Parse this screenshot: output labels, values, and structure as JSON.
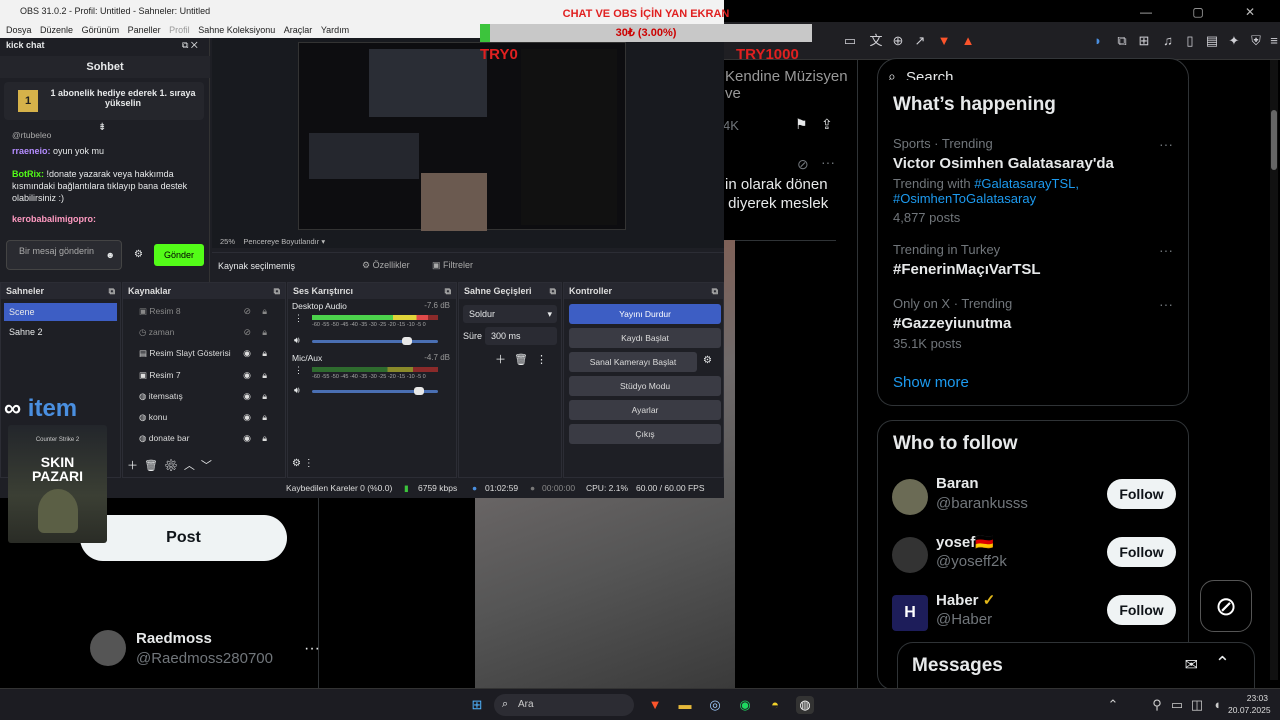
{
  "obs": {
    "title": "OBS 31.0.2 - Profil: Untitled - Sahneler: Untitled",
    "menu": [
      "Dosya",
      "Düzenle",
      "Görünüm",
      "Paneller",
      "Profil",
      "Sahne Koleksiyonu",
      "Araçlar",
      "Yardım"
    ],
    "chat_dock": {
      "title": "kick chat",
      "header": "Sohbet",
      "banner": "1 abonelik hediye ederek 1. sıraya yükselin",
      "rank": "1",
      "handle": "@rtubeleo",
      "messages": [
        {
          "user": "rraeneio:",
          "text": "oyun yok mu"
        },
        {
          "user": "BotRix:",
          "text": "!donate yazarak veya hakkımda kısmındaki bağlantılara tıklayıp bana destek olabilirsiniz :)"
        },
        {
          "user": "kerobabalimigopro:",
          "text": ""
        }
      ],
      "input_placeholder": "Bir mesaj gönderin",
      "send_label": "Gönder"
    },
    "preview": {
      "zoom": "25%",
      "resize_label": "Pencereye Boyutlandır",
      "no_source": "Kaynak seçilmemiş",
      "properties": "Özellikler",
      "filters": "Filtreler"
    },
    "scenes": {
      "title": "Sahneler",
      "items": [
        "Scene",
        "Sahne 2"
      ]
    },
    "sources": {
      "title": "Kaynaklar",
      "items": [
        "Resim 8",
        "zaman",
        "Resim Slayt Gösterisi",
        "Resim 7",
        "itemsatış",
        "konu",
        "donate bar"
      ]
    },
    "mixer": {
      "title": "Ses Karıştırıcı",
      "channels": [
        {
          "name": "Desktop Audio",
          "db": "-7.6 dB",
          "level": 0.92,
          "volume": 0.75
        },
        {
          "name": "Mic/Aux",
          "db": "-4.7 dB",
          "level": 0.0,
          "volume": 0.85
        }
      ],
      "scale": "-60 -55 -50 -45 -40 -35 -30 -25 -20 -15 -10 -5 0"
    },
    "transitions": {
      "title": "Sahne Geçişleri",
      "type": "Soldur",
      "duration_label": "Süre",
      "duration": "300 ms"
    },
    "controls": {
      "title": "Kontroller",
      "buttons": [
        "Yayını Durdur",
        "Kaydı Başlat",
        "Sanal Kamerayı Başlat",
        "Stüdyo Modu",
        "Ayarlar",
        "Çıkış"
      ]
    },
    "status": {
      "dropped": "Kaybedilen Kareler 0 (%0.0)",
      "bitrate": "6759 kbps",
      "live_time": "01:02:59",
      "rec_time": "00:00:00",
      "cpu": "CPU: 2.1%",
      "fps": "60.00 / 60.00 FPS"
    }
  },
  "overlay": {
    "bar_title": "CHAT VE OBS İÇİN YAN EKRAN",
    "bar_value": "30₺ (3.00%)",
    "bar_progress": 0.03,
    "left_amount": "TRY0",
    "right_amount": "TRY1000",
    "skin_title": "SKIN PAZARI",
    "skin_small": "Counter Strike 2",
    "brand": "item"
  },
  "x": {
    "search_placeholder": "Search",
    "whats_happening": "What’s happening",
    "trends": [
      {
        "meta": "Sports · Trending",
        "name": "Victor Osimhen Galatasaray'da",
        "sub_prefix": "Trending with",
        "tags": "#GalatasarayTSL, #OsimhenToGalatasaray",
        "posts": "4,877 posts"
      },
      {
        "meta": "Trending in Turkey",
        "name": "#FenerinMaçıVarTSL"
      },
      {
        "meta": "Only on X · Trending",
        "name": "#Gazzeyiunutma",
        "posts": "35.1K posts"
      }
    ],
    "show_more": "Show more",
    "who_to_follow": "Who to follow",
    "follow": [
      {
        "name": "Baran",
        "handle": "@barankusss"
      },
      {
        "name": "yosef🇩🇪",
        "handle": "@yoseff2k"
      },
      {
        "name": "Haber",
        "handle": "@Haber"
      }
    ],
    "follow_label": "Follow",
    "messages": "Messages",
    "feed_snippet1": "Kendine Müzisyen ve",
    "feed_snippet2": "in olarak dönen",
    "feed_snippet3": "” diyerek meslek",
    "count": "4K",
    "post_btn": "Post",
    "user": {
      "name": "Raedmoss",
      "handle": "@Raedmoss280700"
    }
  },
  "taskbar": {
    "search": "Ara",
    "time": "23:03",
    "date": "20.07.2025"
  }
}
